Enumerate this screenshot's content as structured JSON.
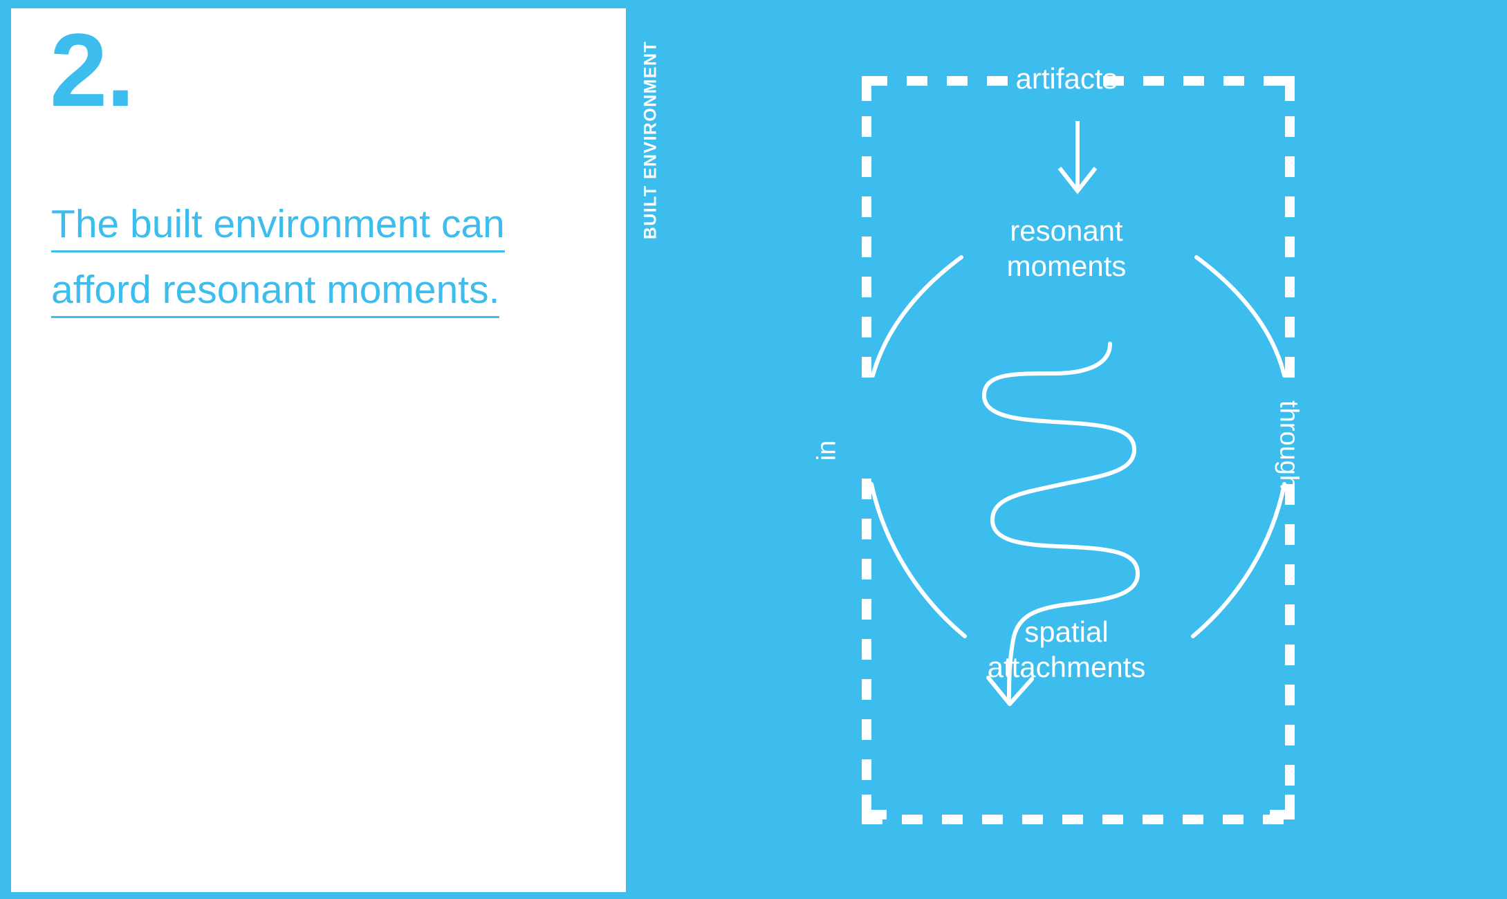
{
  "slide": {
    "background_color": "#3cbdee",
    "accent_color": "#3cbdee",
    "card_background": "#ffffff",
    "diagram_stroke": "#ffffff"
  },
  "card": {
    "number": "2.",
    "headline_line_1": "The built environment can",
    "headline_line_2": "afford resonant moments."
  },
  "diagram": {
    "frame_label": "BUILT ENVIRONMENT",
    "nodes": [
      {
        "id": "artifacts",
        "label": "artifacts"
      },
      {
        "id": "resonant-moments",
        "label_line_1": "resonant",
        "label_line_2": "moments"
      },
      {
        "id": "spatial-attachments",
        "label_line_1": "spatial",
        "label_line_2": "attachments"
      }
    ],
    "edge_labels": [
      {
        "id": "in",
        "label": "in"
      },
      {
        "id": "through",
        "label": "through"
      }
    ]
  }
}
